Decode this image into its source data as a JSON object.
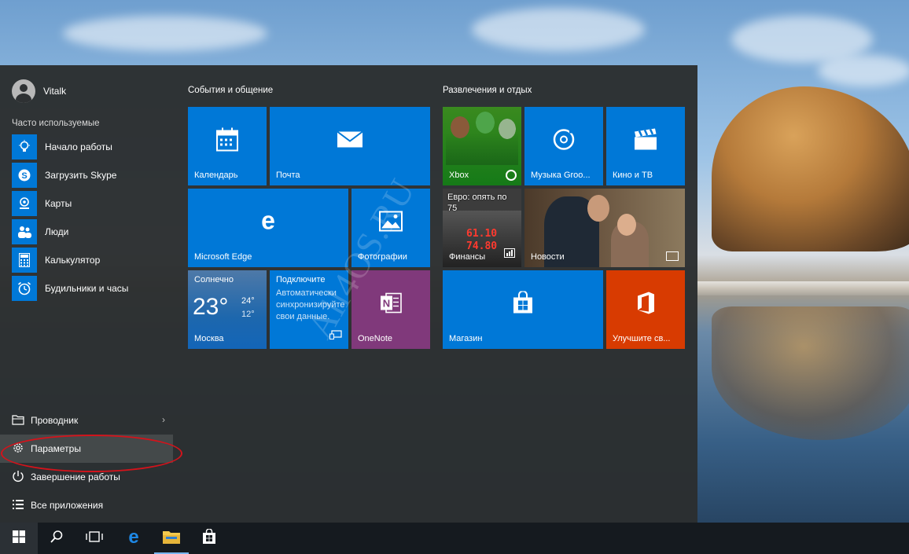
{
  "user": {
    "name": "Vitalk"
  },
  "frequent": {
    "title": "Часто используемые",
    "items": [
      {
        "label": "Начало работы",
        "icon": "lightbulb-icon"
      },
      {
        "label": "Загрузить Skype",
        "icon": "skype-icon"
      },
      {
        "label": "Карты",
        "icon": "maps-icon"
      },
      {
        "label": "Люди",
        "icon": "people-icon"
      },
      {
        "label": "Калькулятор",
        "icon": "calculator-icon"
      },
      {
        "label": "Будильники и часы",
        "icon": "alarm-clock-icon"
      }
    ]
  },
  "bottom": {
    "explorer": "Проводник",
    "settings": "Параметры",
    "shutdown": "Завершение работы",
    "all_apps": "Все приложения"
  },
  "groups": {
    "left_title": "События и общение",
    "right_title": "Развлечения и отдых"
  },
  "tiles": {
    "calendar": "Календарь",
    "mail": "Почта",
    "edge": "Microsoft Edge",
    "photos": "Фотографии",
    "weather": {
      "condition": "Солнечно",
      "temp": "23°",
      "high": "24°",
      "low": "12°",
      "city": "Москва"
    },
    "connect": {
      "title": "Подключите",
      "body": "Автоматически синхронизируйте свои данные."
    },
    "onenote": "OneNote",
    "xbox": "Xbox",
    "music": "Музыка Groo...",
    "movies": "Кино и ТВ",
    "finance": {
      "headline": "Евро: опять по 75",
      "label": "Финансы",
      "digits_1": "61.10",
      "digits_2": "74.80"
    },
    "news": "Новости",
    "store": "Магазин",
    "office": "Улучшите св..."
  },
  "watermark": "All4OS.RU",
  "colors": {
    "tile_blue": "#0078d7",
    "onenote": "#80397b",
    "office": "#d83b01",
    "xbox": "#107c10",
    "highlight": "#d3131b"
  }
}
